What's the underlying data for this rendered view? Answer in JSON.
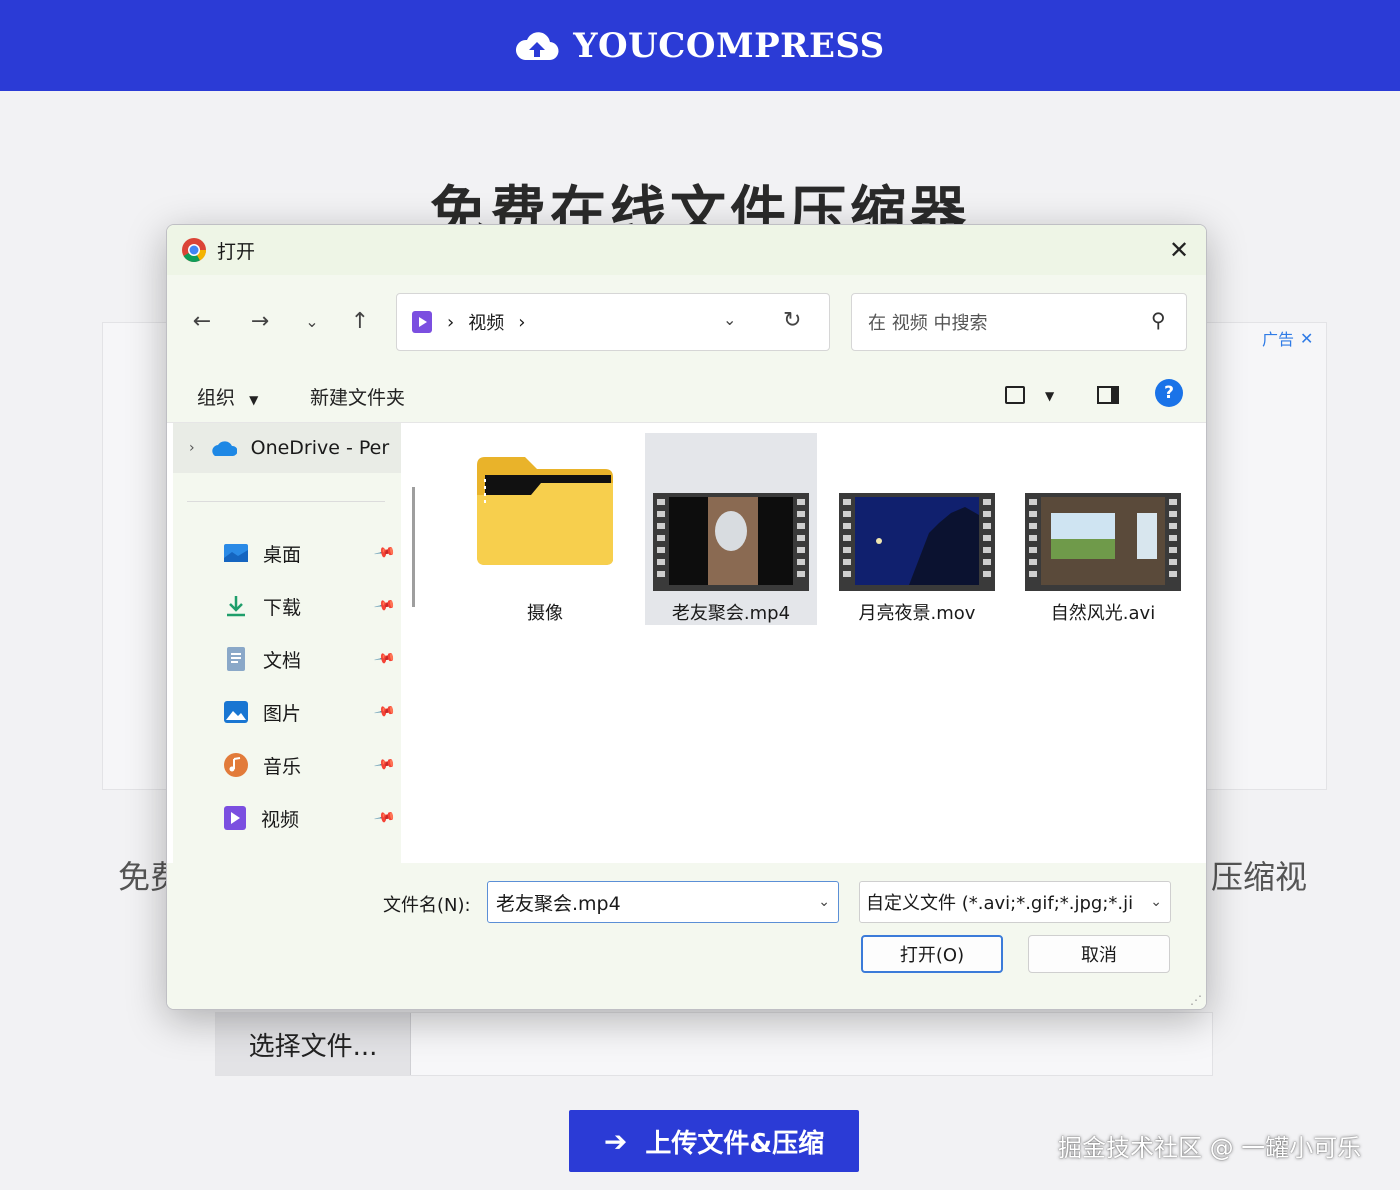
{
  "site": {
    "brand": "YOUCOMPRESS",
    "hero_title": "免费在线文件压缩器",
    "ad_label": "广告",
    "left_fragment": "免费",
    "right_fragment": "压缩视",
    "choose_file": "选择文件...",
    "upload_button": "上传文件&压缩",
    "watermark": "掘金技术社区 @ 一罐小可乐"
  },
  "dialog": {
    "title": "打开",
    "address": {
      "segments": [
        "视频"
      ]
    },
    "search_placeholder": "在 视频 中搜索",
    "toolbar": {
      "organize": "组织",
      "new_folder": "新建文件夹"
    },
    "nav_tree": {
      "onedrive": "OneDrive - Per"
    },
    "quick_access": [
      {
        "label": "桌面",
        "icon": "desktop-icon"
      },
      {
        "label": "下载",
        "icon": "download-icon"
      },
      {
        "label": "文档",
        "icon": "documents-icon"
      },
      {
        "label": "图片",
        "icon": "pictures-icon"
      },
      {
        "label": "音乐",
        "icon": "music-icon"
      },
      {
        "label": "视频",
        "icon": "videos-icon"
      }
    ],
    "files": [
      {
        "name": "摄像",
        "kind": "folder"
      },
      {
        "name": "老友聚会.mp4",
        "kind": "video",
        "selected": true
      },
      {
        "name": "月亮夜景.mov",
        "kind": "video"
      },
      {
        "name": "自然风光.avi",
        "kind": "video"
      }
    ],
    "filename_label": "文件名(N):",
    "filename_value": "老友聚会.mp4",
    "filter_value": "自定义文件 (*.avi;*.gif;*.jpg;*.ji",
    "open_button": "打开(O)",
    "cancel_button": "取消"
  },
  "colors": {
    "brand_blue": "#2b3bd6",
    "dialog_tint": "#f4f8ef",
    "selection": "#e4e6ea"
  }
}
